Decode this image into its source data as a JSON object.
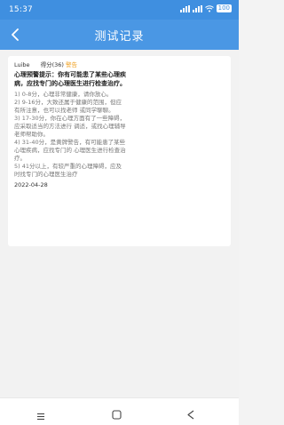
{
  "status_bar": {
    "time": "15:37",
    "battery": "100"
  },
  "app_bar": {
    "title": "测试记录"
  },
  "record": {
    "user": "Luibe",
    "score": "得分(36)",
    "level": "警告",
    "tip": "心理预警提示：你有可能患了某些心理疾病，应找专门的心理医生进行检查治疗。",
    "rules": [
      "1) 0-8分，心理非常健康，请你放心。",
      "2) 9-16分，大致还属于健康的范围，但应有所注意，也可以找老师 或同学聊聊。",
      "3) 17-30分，你在心理方面有了一些障碍，应采取适当的方法进行 调适，或找心理辅导老师帮助你。",
      "4) 31-40分，是黄牌警告，有可能患了某些心理疾病，应找专门的 心理医生进行检查治疗。",
      "5) 41分以上，有较严重的心理障碍，应及时找专门的心理医生治疗"
    ],
    "date": "2022-04-28"
  },
  "colors": {
    "primary": "#4a97e4",
    "warning": "#f0a020"
  }
}
